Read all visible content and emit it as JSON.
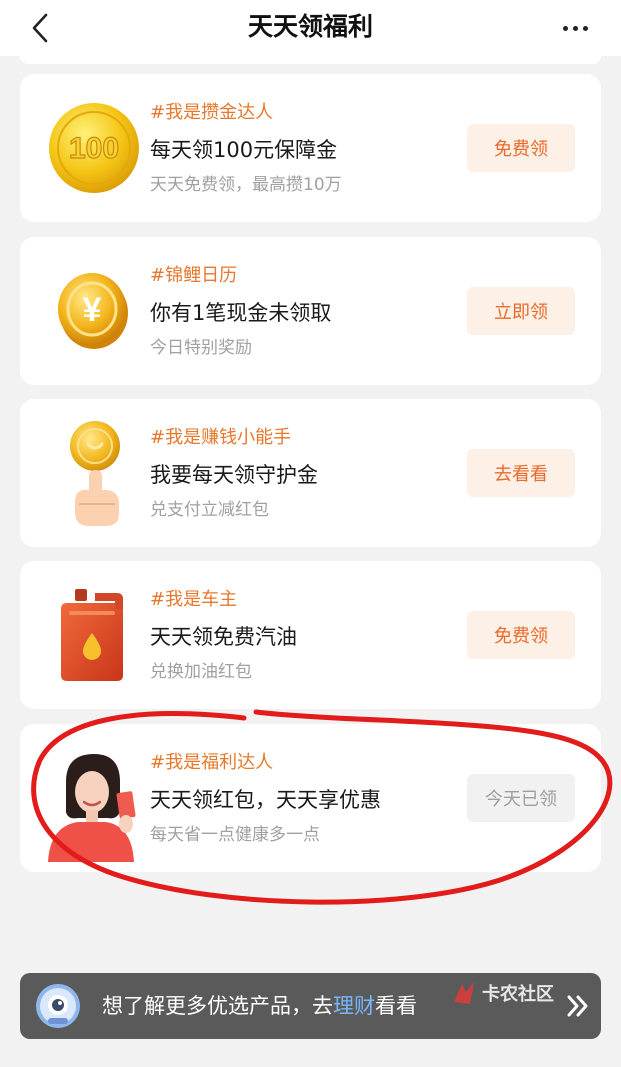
{
  "navbar": {
    "title": "天天领福利",
    "back_icon": "chevron-left-icon",
    "more_icon": "more-dots-icon"
  },
  "cards": [
    {
      "tag": "#我是攒金达人",
      "title": "每天领100元保障金",
      "subtitle": "天天免费领，最高攒10万",
      "button": "免费领",
      "icon": "gold-coin-100-icon",
      "coin_label": "100"
    },
    {
      "tag": "#锦鲤日历",
      "title": "你有1笔现金未领取",
      "subtitle": "今日特别奖励",
      "button": "立即领",
      "icon": "yuan-coin-icon",
      "coin_label": "¥"
    },
    {
      "tag": "#我是赚钱小能手",
      "title": "我要每天领守护金",
      "subtitle": "兑支付立减红包",
      "button": "去看看",
      "icon": "coin-on-finger-icon"
    },
    {
      "tag": "#我是车主",
      "title": "天天领免费汽油",
      "subtitle": "兑换加油红包",
      "button": "免费领",
      "icon": "fuel-can-icon"
    },
    {
      "tag": "#我是福利达人",
      "title": "天天领红包，天天享优惠",
      "subtitle": "每天省一点健康多一点",
      "button": "今天已领",
      "icon": "woman-with-red-envelope-icon"
    }
  ],
  "banner": {
    "text_before": "想了解更多优选产品，去",
    "link": "理财",
    "text_after": "看看",
    "icon": "robot-assistant-icon",
    "arrow_icon": "double-chevron-right-icon"
  },
  "watermark": {
    "text": "卡农社区",
    "icon": "watermark-logo-icon"
  },
  "colors": {
    "tag": "#e8782c",
    "button_bg": "#fdf0e7",
    "button_text": "#ea6a2a",
    "disabled_bg": "#f1f1f1",
    "annotation": "#e21b1b",
    "banner_bg": "#5a5a5a",
    "banner_link": "#79b6ff"
  }
}
